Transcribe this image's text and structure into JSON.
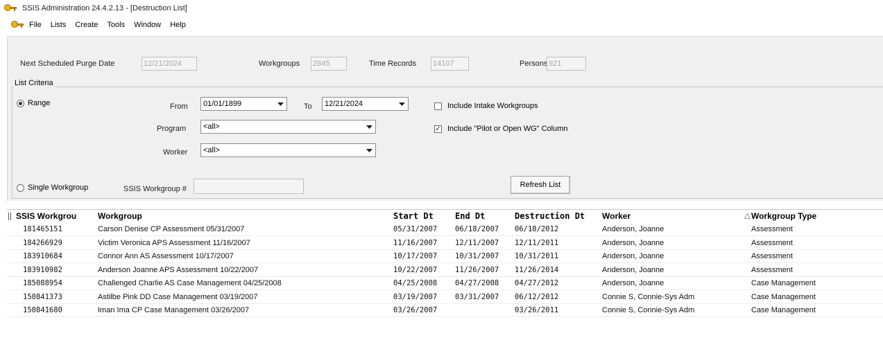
{
  "window": {
    "title": "SSIS Administration  24.4.2.13 - [Destruction List]",
    "app_icon": "key-icon"
  },
  "menu": [
    "File",
    "Lists",
    "Create",
    "Tools",
    "Window",
    "Help"
  ],
  "summary": {
    "purge_label": "Next Scheduled Purge Date",
    "purge_value": "12/21/2024",
    "workgroups_label": "Workgroups",
    "workgroups_value": "2845",
    "time_records_label": "Time Records",
    "time_records_value": "14107",
    "persons_label": "Persons",
    "persons_value": "921"
  },
  "criteria": {
    "group_label": "List Criteria",
    "range_label": "Range",
    "range_selected": true,
    "from_label": "From",
    "from_value": "01/01/1899",
    "to_label": "To",
    "to_value": "12/21/2024",
    "program_label": "Program",
    "program_value": "<all>",
    "worker_label": "Worker",
    "worker_value": "<all>",
    "include_intake_label": "Include Intake Workgroups",
    "include_intake_checked": false,
    "include_pilot_label": "Include \"Pilot or Open WG\" Column",
    "include_pilot_checked": true,
    "single_workgroup_label": "Single Workgroup",
    "ssis_workgroup_label": "SSIS Workgroup #",
    "ssis_workgroup_value": "",
    "refresh_button_label": "Refresh List"
  },
  "table": {
    "columns": [
      "SSIS Workgrou",
      "Workgroup",
      "Start Dt",
      "End Dt",
      "Destruction Dt",
      "Worker",
      "Workgroup Type"
    ],
    "sort_indicator": "sort-up-icon",
    "rows": [
      [
        "181465151",
        "Carson Denise CP Assessment 05/31/2007",
        "05/31/2007",
        "06/18/2007",
        "06/18/2012",
        "Anderson, Joanne",
        "Assessment"
      ],
      [
        "184266929",
        "Victim Veronica APS Assessment 11/16/2007",
        "11/16/2007",
        "12/11/2007",
        "12/11/2011",
        "Anderson, Joanne",
        "Assessment"
      ],
      [
        "183910684",
        "Connor Ann AS Assessment 10/17/2007",
        "10/17/2007",
        "10/31/2007",
        "10/31/2011",
        "Anderson, Joanne",
        "Assessment"
      ],
      [
        "183910982",
        "Anderson Joanne APS Assessment 10/22/2007",
        "10/22/2007",
        "11/26/2007",
        "11/26/2014",
        "Anderson, Joanne",
        "Assessment"
      ],
      [
        "185088954",
        "Challenged Charlie AS Case Management 04/25/2008",
        "04/25/2008",
        "04/27/2008",
        "04/27/2012",
        "Anderson, Joanne",
        "Case Management"
      ],
      [
        "150841373",
        "Astilbe Pink DD Case Management 03/19/2007",
        "03/19/2007",
        "03/31/2007",
        "06/12/2012",
        "Connie S, Connie-Sys Adm",
        "Case Management"
      ],
      [
        "150841680",
        "Iman Ima CP Case Management 03/26/2007",
        "03/26/2007",
        "",
        "03/26/2011",
        "Connie S, Connie-Sys Adm",
        "Case Management"
      ]
    ]
  }
}
